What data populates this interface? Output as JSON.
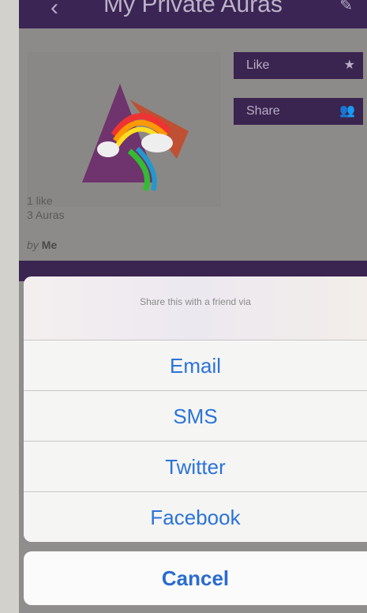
{
  "nav": {
    "title": "My Private Auras",
    "back_icon": "chevron-left-icon",
    "edit_icon": "pencil-icon"
  },
  "actions": {
    "like_label": "Like",
    "like_icon": "star-icon",
    "share_label": "Share",
    "share_icon": "people-icon"
  },
  "meta": {
    "likes": "1 like",
    "auras": "3 Auras",
    "by_prefix": "by",
    "by_name": "Me"
  },
  "share_sheet": {
    "header": "Share this with a friend via",
    "options": [
      "Email",
      "SMS",
      "Twitter",
      "Facebook"
    ],
    "cancel_label": "Cancel"
  },
  "colors": {
    "nav": "#3b2554",
    "action_blue": "#2b73d9"
  }
}
